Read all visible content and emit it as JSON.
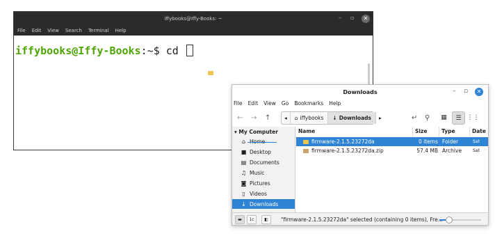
{
  "terminal": {
    "title": "iffybooks@Iffy-Books: ~",
    "menu": [
      "File",
      "Edit",
      "View",
      "Search",
      "Terminal",
      "Help"
    ],
    "prompt_user": "iffybooks@Iffy-Books",
    "prompt_path": ":~$ ",
    "command": "cd "
  },
  "file_manager": {
    "title": "Downloads",
    "menu": [
      "File",
      "Edit",
      "View",
      "Go",
      "Bookmarks",
      "Help"
    ],
    "path": [
      "iffybooks",
      "Downloads"
    ],
    "sidebar": {
      "header": "My Computer",
      "items": [
        "Home",
        "Desktop",
        "Documents",
        "Music",
        "Pictures",
        "Videos",
        "Downloads"
      ],
      "active": "Downloads"
    },
    "columns": [
      "Name",
      "Size",
      "Type",
      "Date"
    ],
    "files": [
      {
        "name": "firmware-2.1.5.23272da",
        "size": "0 items",
        "type": "Folder",
        "date": "Sat",
        "selected": true,
        "color": "#f0c250"
      },
      {
        "name": "firmware-2.1.5.23272da.zip",
        "size": "57.4 MB",
        "type": "Archive",
        "date": "Sat",
        "selected": false,
        "color": "#c9a46a"
      }
    ],
    "status": "\"firmware-2.1.5.23272da\" selected (containing 0 items), Fre...",
    "status_buttons": [
      "1c"
    ],
    "accent": "#2f83d5"
  }
}
